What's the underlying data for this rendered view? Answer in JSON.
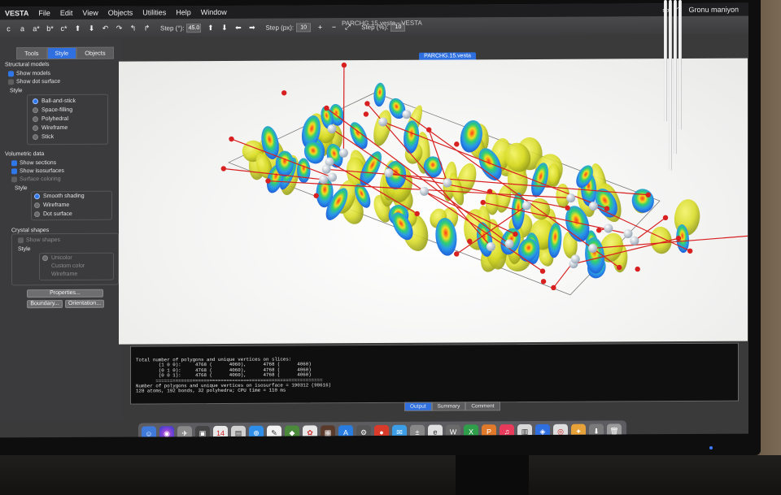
{
  "menubar": {
    "app": "VESTA",
    "items": [
      "File",
      "Edit",
      "View",
      "Objects",
      "Utilities",
      "Help",
      "Window"
    ],
    "user": "Gronu maniyon"
  },
  "window": {
    "title": "PARCHG.15.vesta - VESTA"
  },
  "toolbar": {
    "step_deg_label": "Step (°):",
    "step_deg_value": "45.0",
    "step_px_label": "Step (px):",
    "step_px_value": "10",
    "step_pct_label": "Step (%):",
    "step_pct_value": "10"
  },
  "panel": {
    "tabs": [
      "Tools",
      "Style",
      "Objects"
    ],
    "active_tab": "Style",
    "structural_models": {
      "title": "Structural models",
      "show_models": "Show models",
      "show_dot_surface": "Show dot surface",
      "style_title": "Style",
      "styles": [
        "Ball-and-stick",
        "Space-filling",
        "Polyhedral",
        "Wireframe",
        "Stick"
      ],
      "selected_style": "Ball-and-stick"
    },
    "volumetric": {
      "title": "Volumetric data",
      "show_sections": "Show sections",
      "show_isosurfaces": "Show isosurfaces",
      "surface_coloring": "Surface coloring",
      "style_title": "Style",
      "styles": [
        "Smooth shading",
        "Wireframe",
        "Dot surface"
      ],
      "selected_style": "Smooth shading"
    },
    "crystal": {
      "title": "Crystal shapes",
      "show_shapes": "Show shapes",
      "style_title": "Style",
      "styles": [
        "Unicolor",
        "Custom color",
        "Wireframe"
      ]
    },
    "buttons": {
      "properties": "Properties...",
      "boundary": "Boundary...",
      "orientation": "Orientation..."
    }
  },
  "viewer": {
    "tab": "PARCHG.15.vesta"
  },
  "console": {
    "lines": [
      "Total number of polygons and unique vertices on slices:",
      "        (1 0 0):     4768 (      4060),      4768 (      4060)",
      "        (0 1 0):     4768 (      4060),      4768 (      4060)",
      "        (0 0 1):     4768 (      4060),      4768 (      4060)",
      "       ===========================================================",
      "",
      "Number of polygons and unique vertices on isosurface = 190312 (98616)",
      "128 atoms, 192 bonds, 32 polyhedra; CPU time = 110 ms"
    ],
    "tabs": [
      "Output",
      "Summary",
      "Comment"
    ],
    "active_tab": "Output"
  },
  "colors": {
    "accent": "#2f6fe0",
    "isosurface_yellow": "#d9dc2a",
    "isosurface_blue": "#1f5fd8",
    "atom_red": "#d82020",
    "atom_grey": "#9aa8b8"
  }
}
